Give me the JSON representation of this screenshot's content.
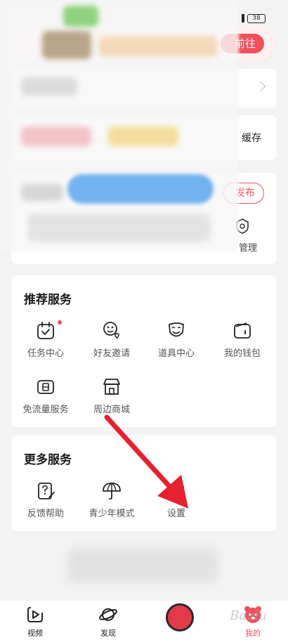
{
  "status_bar": {
    "battery": "38"
  },
  "banner": {
    "button_label": "前往"
  },
  "cards": {
    "cache_label": "缓存",
    "publish_label": "发布",
    "manage_label": "管理"
  },
  "recommend": {
    "title": "推荐服务",
    "items": [
      {
        "label": "任务中心",
        "icon": "task-center-icon"
      },
      {
        "label": "好友邀请",
        "icon": "friend-invite-icon"
      },
      {
        "label": "道具中心",
        "icon": "props-center-icon"
      },
      {
        "label": "我的钱包",
        "icon": "wallet-icon"
      },
      {
        "label": "免流量服务",
        "icon": "free-data-icon"
      },
      {
        "label": "周边商城",
        "icon": "shop-icon"
      }
    ]
  },
  "more": {
    "title": "更多服务",
    "items": [
      {
        "label": "反馈帮助",
        "icon": "feedback-help-icon"
      },
      {
        "label": "青少年模式",
        "icon": "teen-mode-icon"
      },
      {
        "label": "设置",
        "icon": "settings-icon"
      }
    ]
  },
  "tabbar": {
    "tabs": [
      {
        "label": "视频"
      },
      {
        "label": "发现"
      },
      {
        "label": "我的"
      }
    ]
  },
  "watermark": "Baidu",
  "colors": {
    "accent": "#f24f5c",
    "arrow": "#e8212f"
  }
}
